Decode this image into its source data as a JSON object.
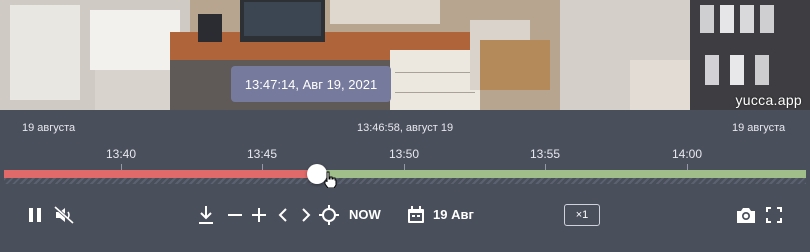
{
  "video": {
    "watermark": "yucca.app",
    "hover_time": "13:47:14, Авг 19, 2021"
  },
  "timeline": {
    "left_date": "19 августа",
    "center_datetime": "13:46:58, август 19",
    "right_date": "19 августа",
    "ticks": [
      "13:40",
      "13:45",
      "13:50",
      "13:55",
      "14:00"
    ],
    "playhead_fraction": 0.39
  },
  "controls": {
    "now_label": "NOW",
    "date_label": "19 Авг",
    "speed_label": "×1",
    "icons": {
      "pause": "pause-icon",
      "mute": "volume-muted-icon",
      "download": "download-icon",
      "zoom_out": "minus-icon",
      "zoom_in": "plus-icon",
      "prev": "chevron-left-icon",
      "next": "chevron-right-icon",
      "now": "crosshair-icon",
      "calendar": "calendar-icon",
      "snapshot": "camera-icon",
      "fullscreen": "fullscreen-icon"
    }
  },
  "colors": {
    "background": "#4a4f5c",
    "recorded_past": "#e06a6a",
    "recorded_future": "#9fbe8a",
    "tooltip": "#767a9c"
  }
}
